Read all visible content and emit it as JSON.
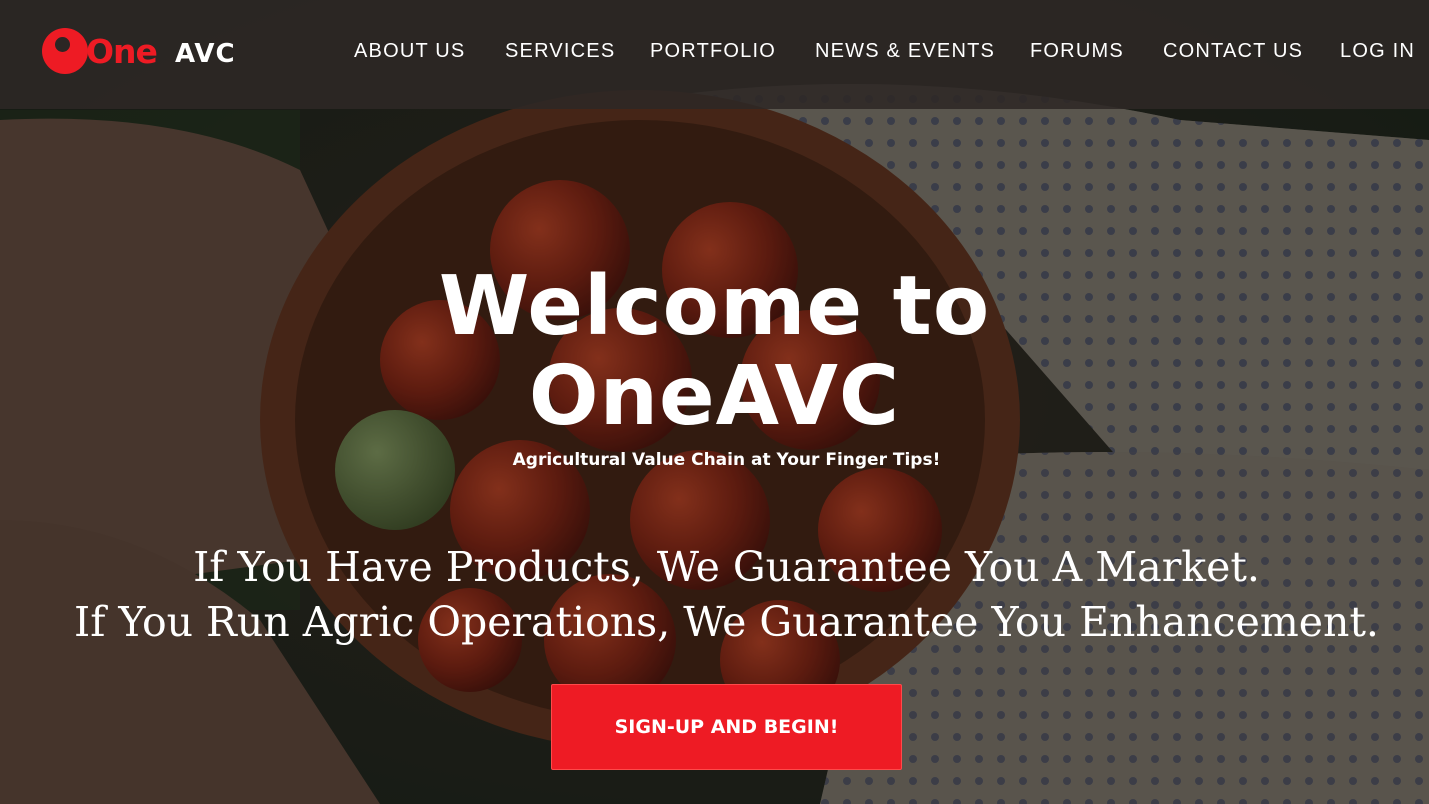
{
  "brand": {
    "name_part1": "One",
    "name_part2": "AVC",
    "color": "#ee1b24"
  },
  "nav": {
    "items": [
      {
        "label": "ABOUT US"
      },
      {
        "label": "SERVICES"
      },
      {
        "label": "PORTFOLIO"
      },
      {
        "label": "NEWS & EVENTS"
      },
      {
        "label": "FORUMS"
      },
      {
        "label": "CONTACT US"
      },
      {
        "label": "LOG IN"
      }
    ]
  },
  "hero": {
    "title_line1": "Welcome to",
    "title_line2": "OneAVC",
    "subtitle": "Agricultural Value Chain at Your Finger Tips!",
    "tagline_line1": "If You Have Products, We Guarantee You A Market.",
    "tagline_line2": "If You Run Agric Operations, We Guarantee You Enhancement.",
    "cta_label": "SIGN-UP AND BEGIN!",
    "background_icon": "bowl-of-tomatoes-in-gloved-hands-image"
  },
  "colors": {
    "accent": "#ee1b24",
    "nav_bg": "#2d2826",
    "text": "#ffffff"
  }
}
